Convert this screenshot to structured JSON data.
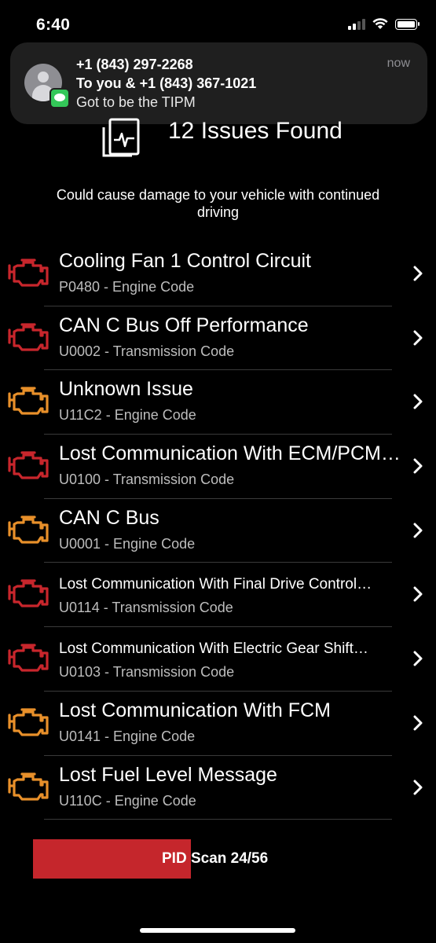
{
  "status_bar": {
    "time": "6:40",
    "signal_bars_filled": 2,
    "signal_bars_total": 4
  },
  "notification": {
    "title": "+1 (843) 297-2268",
    "subtitle": "To you & +1 (843) 367-1021",
    "body": "Got to be the TIPM",
    "time": "now",
    "app_icon": "messages-icon"
  },
  "header": {
    "title": "12 Issues Found",
    "warning": "Could cause damage to your vehicle with continued driving"
  },
  "colors": {
    "red": "#c8262c",
    "orange": "#e8902a",
    "progress": "#c5262c"
  },
  "issues": [
    {
      "title": "Cooling Fan 1 Control Circuit",
      "code": "P0480 - Engine Code",
      "severity": "red"
    },
    {
      "title": "CAN C Bus Off Performance",
      "code": "U0002 - Transmission Code",
      "severity": "red"
    },
    {
      "title": "Unknown Issue",
      "code": "U11C2 - Engine Code",
      "severity": "orange"
    },
    {
      "title": "Lost Communication With ECM/PCM \"A\"",
      "code": "U0100 - Transmission Code",
      "severity": "red"
    },
    {
      "title": "CAN C Bus",
      "code": "U0001 - Engine Code",
      "severity": "orange"
    },
    {
      "title": "Lost Communication With Final Drive Control…",
      "code": "U0114 - Transmission Code",
      "severity": "red"
    },
    {
      "title": "Lost Communication With Electric Gear Shift…",
      "code": "U0103 - Transmission Code",
      "severity": "red"
    },
    {
      "title": "Lost Communication With FCM",
      "code": "U0141 - Engine Code",
      "severity": "orange"
    },
    {
      "title": "Lost Fuel Level Message",
      "code": "U110C - Engine Code",
      "severity": "orange"
    }
  ],
  "progress": {
    "label": "PID Scan 24/56",
    "current": 24,
    "total": 56
  }
}
